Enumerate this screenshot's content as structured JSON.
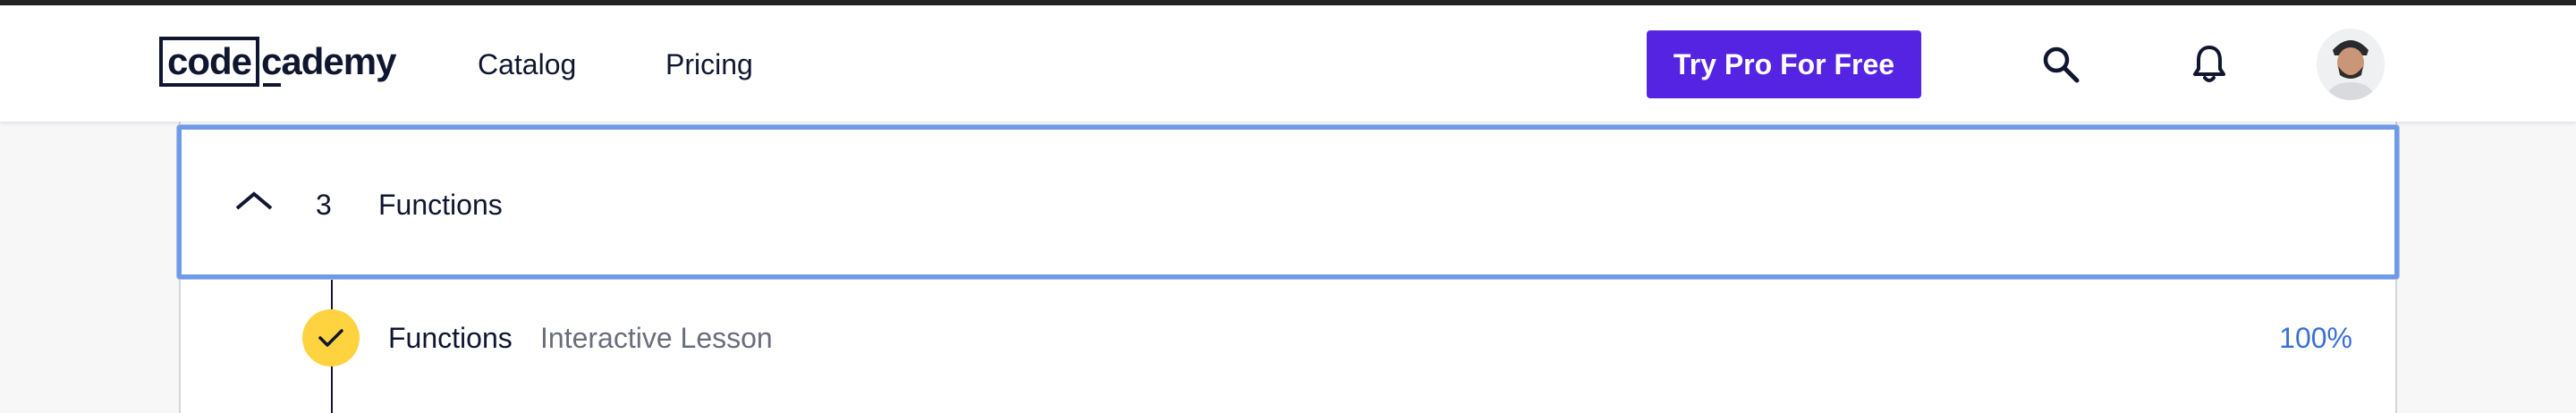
{
  "header": {
    "logo": {
      "box_text": "code",
      "rest_text": "cademy"
    },
    "nav": [
      {
        "label": "Catalog"
      },
      {
        "label": "Pricing"
      }
    ],
    "cta_label": "Try Pro For Free",
    "icons": [
      "search-icon",
      "bell-icon"
    ],
    "colors": {
      "cta_bg": "#5523e2",
      "text": "#10162f"
    }
  },
  "module": {
    "number": "3",
    "title": "Functions",
    "expanded": true,
    "highlight_color": "#6e9ae8"
  },
  "lessons": [
    {
      "title": "Functions",
      "type": "Interactive Lesson",
      "progress": "100%",
      "completed": true,
      "badge_color": "#ffd340"
    }
  ]
}
